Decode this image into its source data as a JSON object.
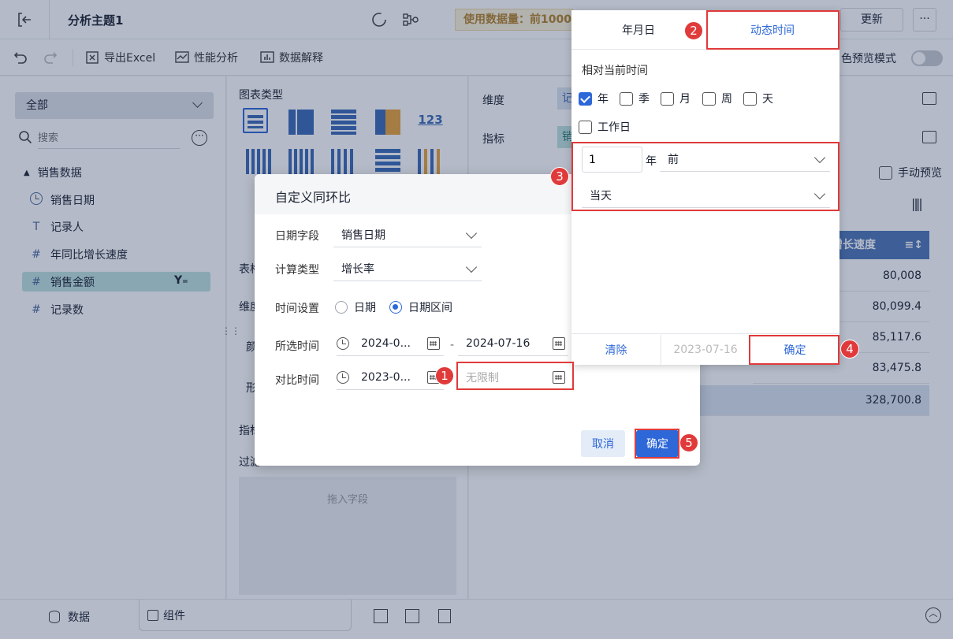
{
  "topbar": {
    "title": "分析主题1",
    "data_usage": "使用数据量：前1000",
    "update_label": "更新"
  },
  "toolbar": {
    "export_label": "导出Excel",
    "perf_label": "性能分析",
    "explain_label": "数据解释",
    "preview_mode_label": "色预览模式"
  },
  "left": {
    "filter_label": "全部",
    "search_placeholder": "搜索",
    "group_label": "销售数据",
    "fields": [
      {
        "label": "销售日期",
        "icon": "clock-icon"
      },
      {
        "label": "记录人",
        "icon": "text-icon"
      },
      {
        "label": "年同比增长速度",
        "icon": "hash-icon"
      },
      {
        "label": "销售金额",
        "icon": "hash-icon"
      },
      {
        "label": "记录数",
        "icon": "hash-icon"
      }
    ]
  },
  "mid": {
    "chart_type_label": "图表类型",
    "number_chart_label": "123",
    "table_label": "表格",
    "dim_label": "维度",
    "color_label": "颜",
    "shape_label": "形",
    "metric_label": "指标",
    "filter_label": "过滤",
    "drop_label": "拖入字段"
  },
  "right": {
    "dim_label": "维度",
    "dim_chip": "记",
    "metric_label": "指标",
    "metric_chip": "销",
    "manual_preview_label": "手动预览",
    "column_header": "增长速度",
    "values": [
      "80,008",
      "80,099.4",
      "85,117.6",
      "83,475.8",
      "328,700.8"
    ]
  },
  "bottom": {
    "data_tab": "数据",
    "component_tab": "组件"
  },
  "dialog": {
    "title": "自定义同环比",
    "date_field_label": "日期字段",
    "date_field_value": "销售日期",
    "calc_type_label": "计算类型",
    "calc_type_value": "增长率",
    "time_setting_label": "时间设置",
    "option_date": "日期",
    "option_range": "日期区间",
    "selected_time_label": "所选时间",
    "selected_start": "2024-0...",
    "selected_end": "2024-07-16",
    "compare_time_label": "对比时间",
    "compare_start": "2023-0...",
    "compare_end_placeholder": "无限制",
    "cancel_label": "取消",
    "ok_label": "确定"
  },
  "popup": {
    "tab_date": "年月日",
    "tab_dynamic": "动态时间",
    "relative_label": "相对当前时间",
    "units": [
      {
        "label": "年",
        "checked": true
      },
      {
        "label": "季",
        "checked": false
      },
      {
        "label": "月",
        "checked": false
      },
      {
        "label": "周",
        "checked": false
      },
      {
        "label": "天",
        "checked": false
      }
    ],
    "workday_label": "工作日",
    "offset_value": "1",
    "offset_unit": "年",
    "direction_value": "前",
    "day_value": "当天",
    "clear_label": "清除",
    "preview_date": "2023-07-16",
    "ok_label": "确定"
  },
  "annotations": [
    "1",
    "2",
    "3",
    "4",
    "5"
  ],
  "colors": {
    "accent": "#2d67d8",
    "annotation_red": "#e03a3a",
    "field_highlight": "#bfe3e0",
    "table_header": "#4e76b8"
  }
}
